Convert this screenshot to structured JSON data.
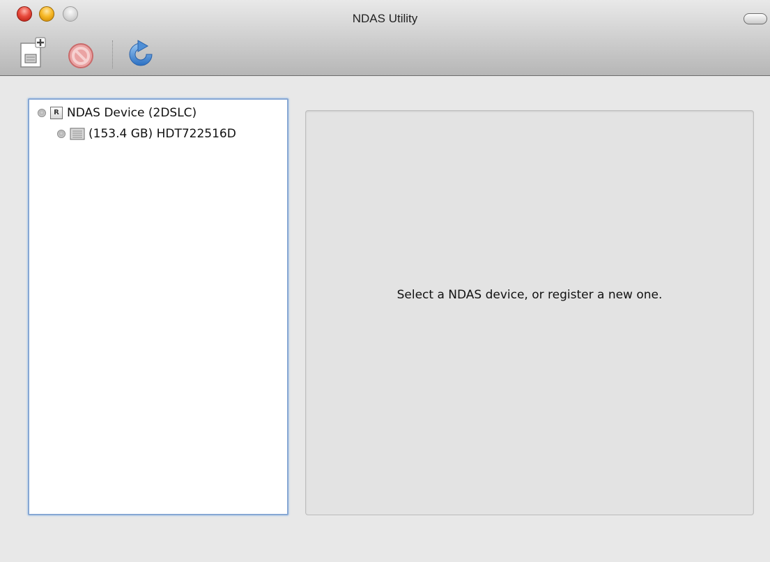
{
  "window": {
    "title": "NDAS Utility"
  },
  "toolbar": {
    "buttons": [
      {
        "name": "register-device",
        "icon": "add-device-icon"
      },
      {
        "name": "unregister-device",
        "icon": "no-entry-icon"
      },
      {
        "name": "refresh",
        "icon": "refresh-icon"
      }
    ]
  },
  "tree": {
    "items": [
      {
        "label": "NDAS Device (2DSLC)",
        "icon": "ndas-device-icon",
        "status": "gray"
      },
      {
        "label": "(153.4 GB) HDT722516D",
        "icon": "hard-disk-icon",
        "status": "gray"
      }
    ]
  },
  "detail": {
    "message": "Select a NDAS device, or register a new one."
  },
  "colors": {
    "close": "#e84b3d",
    "minimize": "#f7b928",
    "zoom": "#d4d4d4",
    "focus_ring": "#86a7d3"
  }
}
